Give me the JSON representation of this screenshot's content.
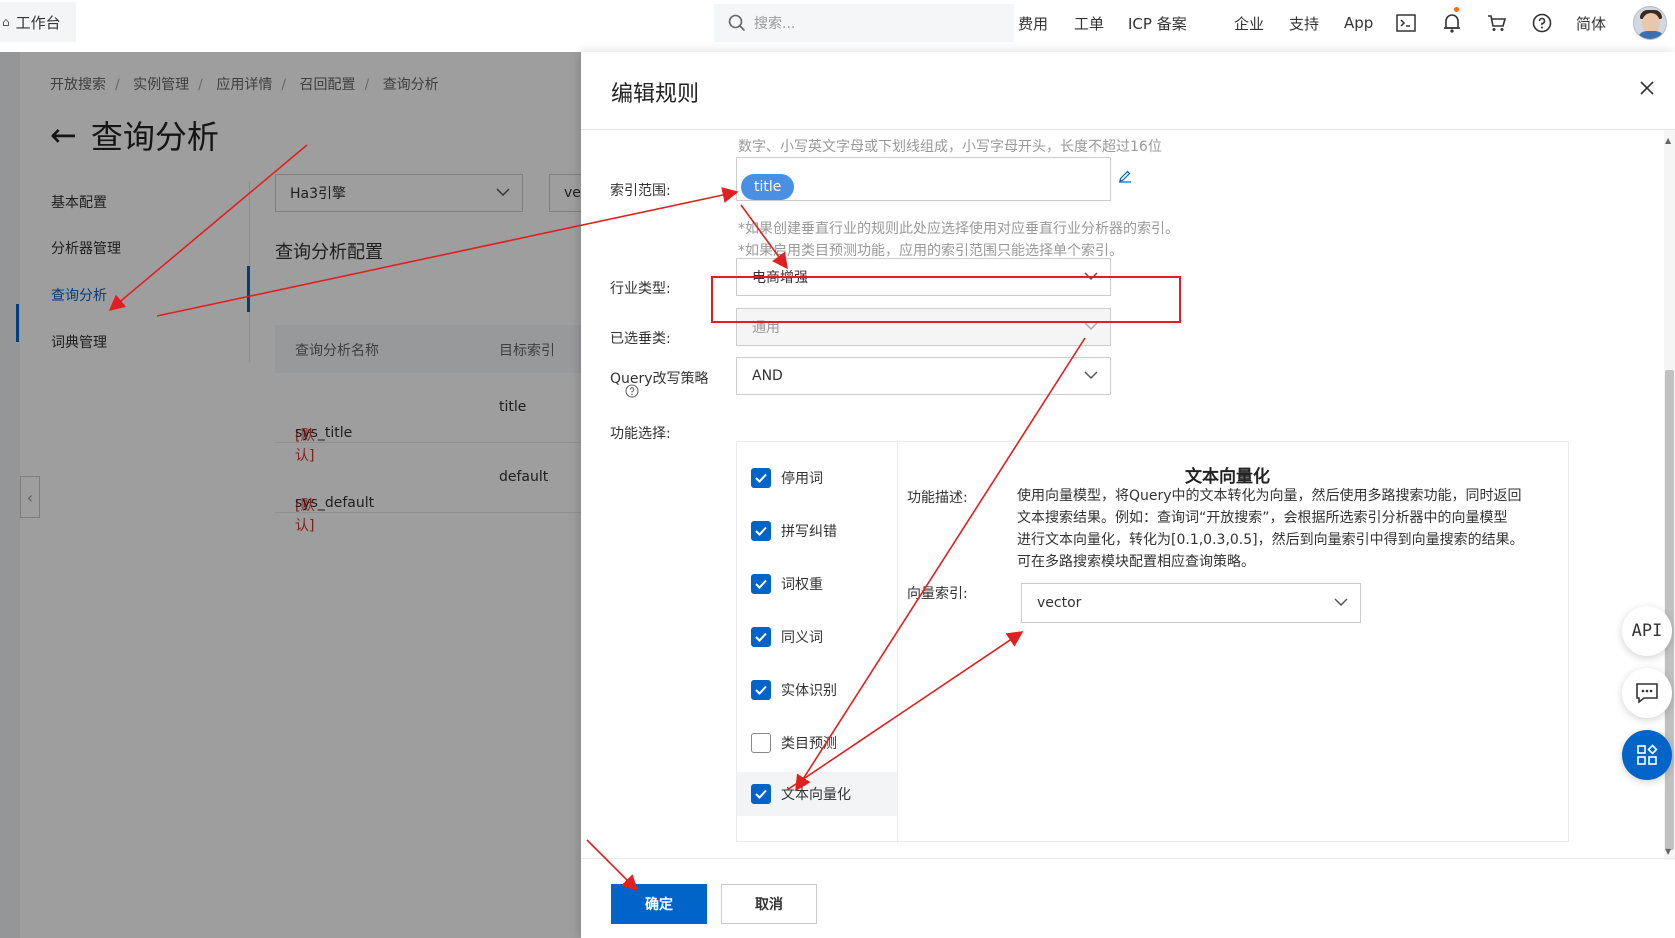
{
  "topbar": {
    "workspace": "工作台",
    "search_placeholder": "搜索...",
    "nav": [
      "费用",
      "工单",
      "ICP 备案",
      "企业",
      "支持",
      "App"
    ],
    "lang": "简体"
  },
  "background": {
    "breadcrumb": [
      "开放搜索",
      "实例管理",
      "应用详情",
      "召回配置",
      "查询分析"
    ],
    "page_title": "查询分析",
    "menu": [
      "基本配置",
      "分析器管理",
      "查询分析",
      "词典管理"
    ],
    "engine_select": "Ha3引擎",
    "second_select": "ve",
    "section_title": "查询分析配置",
    "table": {
      "headers": [
        "查询分析名称",
        "目标索引"
      ],
      "rows": [
        {
          "tag": "[默认]",
          "name": "sys_title",
          "index": "title"
        },
        {
          "tag": "[默认]",
          "name": "sys_default",
          "index": "default"
        }
      ]
    }
  },
  "drawer": {
    "title": "编辑规则",
    "name_hint": "数字、小写英文字母或下划线组成，小写字母开头，长度不超过16位",
    "index_scope_label": "索引范围:",
    "index_tag": "title",
    "index_hint_1": "*如果创建垂直行业的规则此处应选择使用对应垂直行业分析器的索引。",
    "index_hint_2": "*如果启用类目预测功能，应用的索引范围只能选择单个索引。",
    "industry_label": "行业类型:",
    "industry_value": "电商增强",
    "vertical_label": "已选垂类:",
    "vertical_value": "通用",
    "query_label": "Query改写策略",
    "query_value": "AND",
    "feature_label": "功能选择:",
    "features": [
      {
        "label": "停用词",
        "checked": true
      },
      {
        "label": "拼写纠错",
        "checked": true
      },
      {
        "label": "词权重",
        "checked": true
      },
      {
        "label": "同义词",
        "checked": true
      },
      {
        "label": "实体识别",
        "checked": true
      },
      {
        "label": "类目预测",
        "checked": false
      },
      {
        "label": "文本向量化",
        "checked": true
      }
    ],
    "detail": {
      "title": "文本向量化",
      "desc_label": "功能描述:",
      "desc_lines": [
        "使用向量模型，将Query中的文本转化为向量，然后使用多路搜索功能，同时返回",
        "文本搜索结果。例如：查询词“开放搜索”，会根据所选索引分析器中的向量模型",
        "进行文本向量化，转化为[0.1,0.3,0.5]，然后到向量索引中得到向量搜索的结果。",
        "可在多路搜索模块配置相应查询策略。"
      ],
      "vector_label": "向量索引:",
      "vector_value": "vector"
    },
    "ok": "确定",
    "cancel": "取消"
  },
  "floating": {
    "api": "API"
  },
  "colors": {
    "primary": "#0064c8",
    "annotation": "#e02020"
  }
}
